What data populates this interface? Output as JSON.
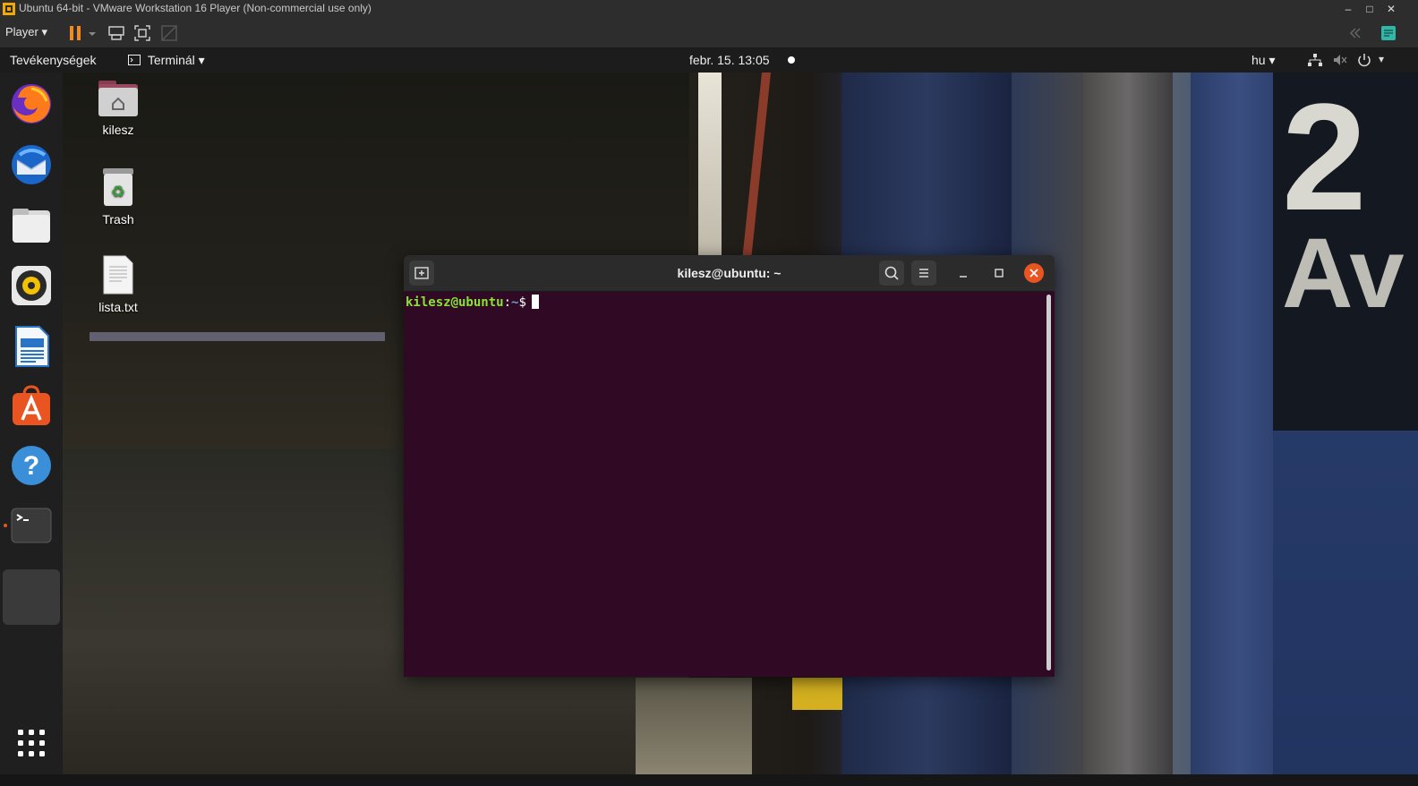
{
  "vmware": {
    "title": "Ubuntu 64-bit - VMware Workstation 16 Player (Non-commercial use only)",
    "player_menu": "Player"
  },
  "topbar": {
    "activities": "Tevékenységek",
    "app_menu": "Terminál",
    "clock": "febr. 15.  13:05",
    "language": "hu"
  },
  "desktop": {
    "icons": [
      {
        "label": "kilesz",
        "icon": "home-folder-icon"
      },
      {
        "label": "Trash",
        "icon": "trash-icon"
      },
      {
        "label": "lista.txt",
        "icon": "text-file-icon"
      }
    ]
  },
  "dock": {
    "items": [
      "firefox-icon",
      "thunderbird-icon",
      "files-icon",
      "rhythmbox-icon",
      "libreoffice-writer-icon",
      "software-center-icon",
      "help-icon",
      "terminal-icon"
    ]
  },
  "terminal": {
    "title": "kilesz@ubuntu: ~",
    "prompt_user": "kilesz@ubuntu",
    "prompt_sep": ":",
    "prompt_path": "~",
    "prompt_sym": "$"
  },
  "wallpaper": {
    "sign_number": "2",
    "sign_text": "Av"
  }
}
